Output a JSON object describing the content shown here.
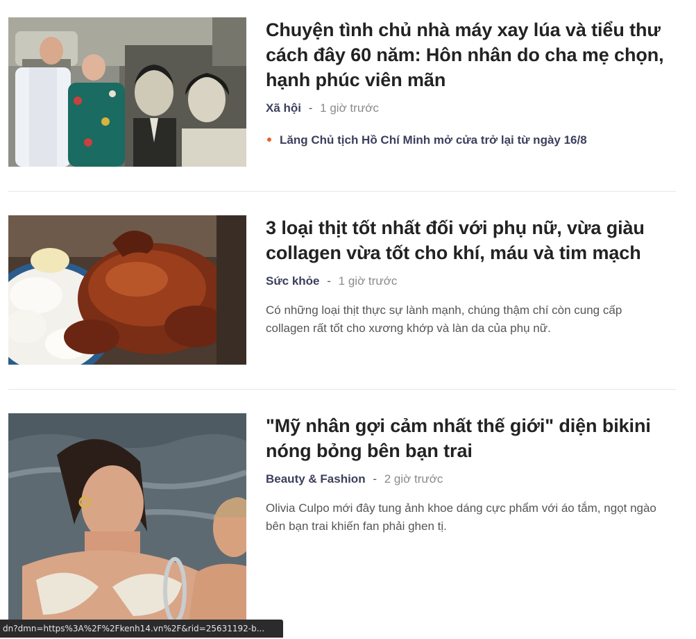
{
  "articles": [
    {
      "title": "Chuyện tình chủ nhà máy xay lúa và tiểu thư cách đây 60 năm: Hôn nhân do cha mẹ chọn, hạnh phúc viên mãn",
      "category": "Xã hội",
      "separator": "-",
      "time": "1 giờ trước",
      "related": "Lăng Chủ tịch Hồ Chí Minh mở cửa trở lại từ ngày 16/8"
    },
    {
      "title": "3 loại thịt tốt nhất đối với phụ nữ, vừa giàu collagen vừa tốt cho khí, máu và tim mạch",
      "category": "Sức khỏe",
      "separator": "-",
      "time": "1 giờ trước",
      "summary": "Có những loại thịt thực sự lành mạnh, chúng thậm chí còn cung cấp collagen rất tốt cho xương khớp và làn da của phụ nữ."
    },
    {
      "title": "\"Mỹ nhân gợi cảm nhất thế giới\" diện bikini nóng bỏng bên bạn trai",
      "category": "Beauty & Fashion",
      "separator": "-",
      "time": "2 giờ trước",
      "summary": "Olivia Culpo mới đây tung ảnh khoe dáng cực phẩm với áo tắm, ngọt ngào bên bạn trai khiến fan phải ghen tị."
    }
  ],
  "status_bar": {
    "url": "dn?dmn=https%3A%2F%2Fkenh14.vn%2F&rid=25631192-b..."
  },
  "colors": {
    "bullet": "#e8622c",
    "category": "#3b3f5c"
  }
}
